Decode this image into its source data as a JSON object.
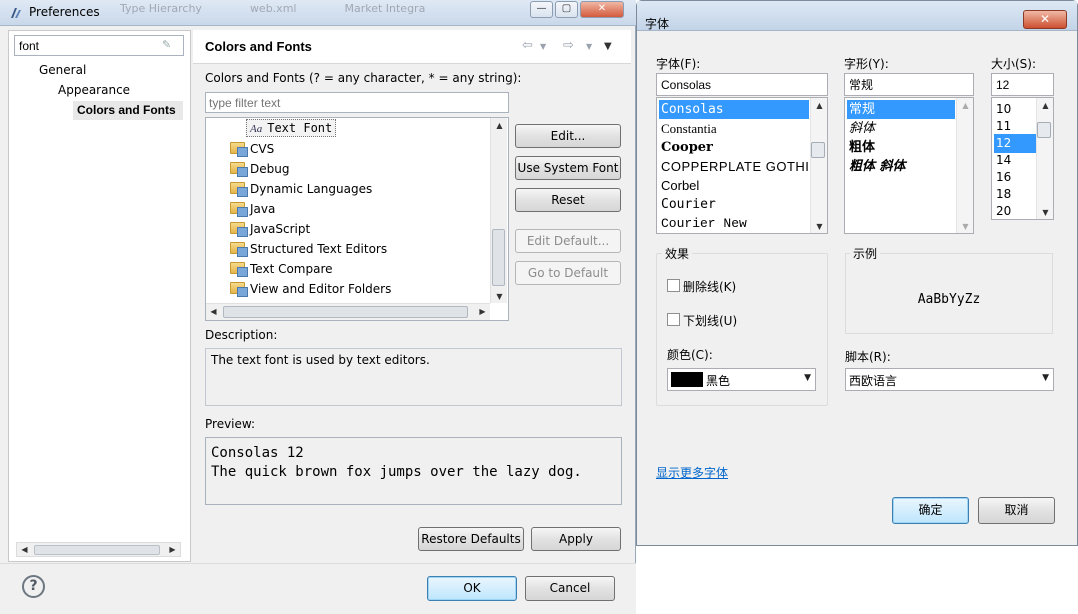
{
  "prefs": {
    "title": "Preferences",
    "ghost_tabs": [
      "Type Hierarchy",
      "web.xml",
      "Market Integra"
    ],
    "filter_value": "font",
    "tree": [
      "General",
      "Appearance",
      "Colors and Fonts"
    ],
    "page_title": "Colors and Fonts",
    "hint": "Colors and Fonts (? = any character, * = any string):",
    "filter_placeholder": "type filter text",
    "selected_item": "Text Font",
    "categories": [
      "CVS",
      "Debug",
      "Dynamic Languages",
      "Java",
      "JavaScript",
      "Structured Text Editors",
      "Text Compare",
      "View and Editor Folders"
    ],
    "buttons": {
      "edit": "Edit...",
      "use_system_font": "Use System Font",
      "reset": "Reset",
      "edit_default": "Edit Default...",
      "go_to_default": "Go to Default",
      "restore_defaults": "Restore Defaults",
      "apply": "Apply",
      "ok": "OK",
      "cancel": "Cancel"
    },
    "description_label": "Description:",
    "description": "The text font is used by text editors.",
    "preview_label": "Preview:",
    "preview_line1": "Consolas 12",
    "preview_line2": "The quick brown fox jumps over the lazy dog.",
    "help": "?"
  },
  "font_dialog": {
    "title": "字体",
    "close": "✕",
    "font_label": "字体(F):",
    "font_value": "Consolas",
    "fonts": [
      "Consolas",
      "Constantia",
      "Cooper",
      "COPPERPLATE GOTHIC",
      "Corbel",
      "Courier",
      "Courier New"
    ],
    "style_label": "字形(Y):",
    "style_value": "常规",
    "styles": [
      "常规",
      "斜体",
      "粗体",
      "粗体 斜体"
    ],
    "size_label": "大小(S):",
    "size_value": "12",
    "sizes": [
      "10",
      "11",
      "12",
      "14",
      "16",
      "18",
      "20"
    ],
    "effects_label": "效果",
    "strike_label": "删除线(K)",
    "underline_label": "下划线(U)",
    "color_label": "颜色(C):",
    "color_value": "黑色",
    "sample_label": "示例",
    "sample_text": "AaBbYyZz",
    "script_label": "脚本(R):",
    "script_value": "西欧语言",
    "more_fonts": "显示更多字体",
    "ok": "确定",
    "cancel": "取消"
  },
  "colors": {
    "selection": "#3399ff",
    "link": "#0066cc",
    "swatch": "#000000"
  }
}
